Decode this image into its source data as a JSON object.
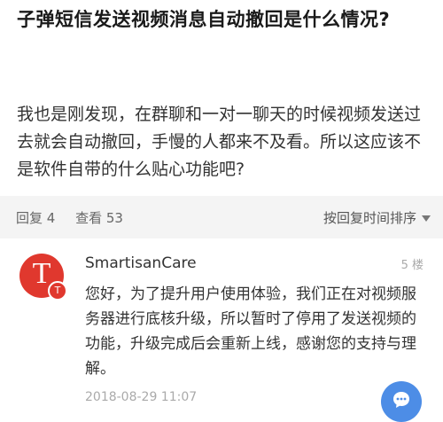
{
  "question": {
    "title": "子弹短信发送视频消息自动撤回是什么情况?",
    "body": "我也是刚发现，在群聊和一对一聊天的时候视频发送过去就会自动撤回，手慢的人都来不及看。所以这应该不是软件自带的什么贴心功能吧?"
  },
  "stats": {
    "reply_label": "回复 4",
    "view_label": "查看 53",
    "sort_label": "按回复时间排序"
  },
  "reply": {
    "avatar_letter": "T",
    "author": "SmartisanCare",
    "floor": "5 楼",
    "content": "您好，为了提升用户使用体验，我们正在对视频服务器进行底核升级，所以暂时了停用了发送视频的功能，升级完成后会重新上线，感谢您的支持与理解。",
    "time": "2018-08-29 11:07"
  },
  "colors": {
    "avatar_red": "#e0382e",
    "fab_blue": "#4d8de6"
  }
}
